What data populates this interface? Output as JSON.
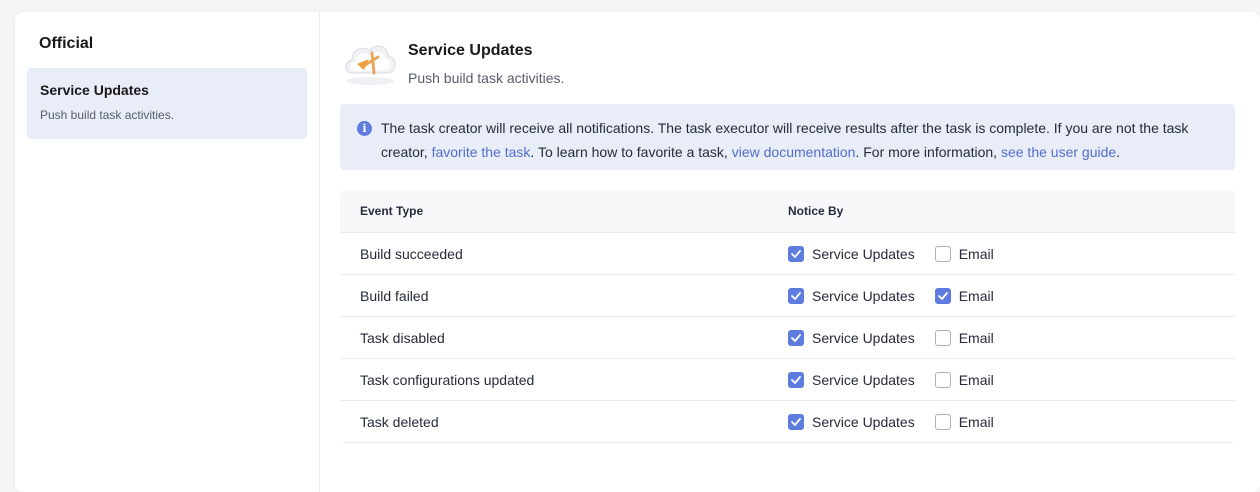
{
  "sidebar": {
    "title": "Official",
    "items": [
      {
        "title": "Service Updates",
        "desc": "Push build task activities."
      }
    ]
  },
  "header": {
    "title": "Service Updates",
    "desc": "Push build task activities.",
    "icon": "cloud-message-icon"
  },
  "info": {
    "icon": "info-icon",
    "text_1": "The task creator will receive all notifications. The task executor will receive results after the task is complete. If you are not the task creator, ",
    "link_1": "favorite the task",
    "text_2": ". To learn how to favorite a task, ",
    "link_2": "view documentation",
    "text_3": ". For more information, ",
    "link_3": "see the user guide",
    "text_4": "."
  },
  "table": {
    "headers": [
      "Event Type",
      "Notice By"
    ],
    "option_labels": [
      "Service Updates",
      "Email"
    ],
    "rows": [
      {
        "event": "Build succeeded",
        "service_updates": true,
        "email": false
      },
      {
        "event": "Build failed",
        "service_updates": true,
        "email": true
      },
      {
        "event": "Task disabled",
        "service_updates": true,
        "email": false
      },
      {
        "event": "Task configurations updated",
        "service_updates": true,
        "email": false
      },
      {
        "event": "Task deleted",
        "service_updates": true,
        "email": false
      }
    ]
  },
  "colors": {
    "accent": "#5e7ce0",
    "link": "#526ecc",
    "highlight_bg": "#e8edf8"
  }
}
